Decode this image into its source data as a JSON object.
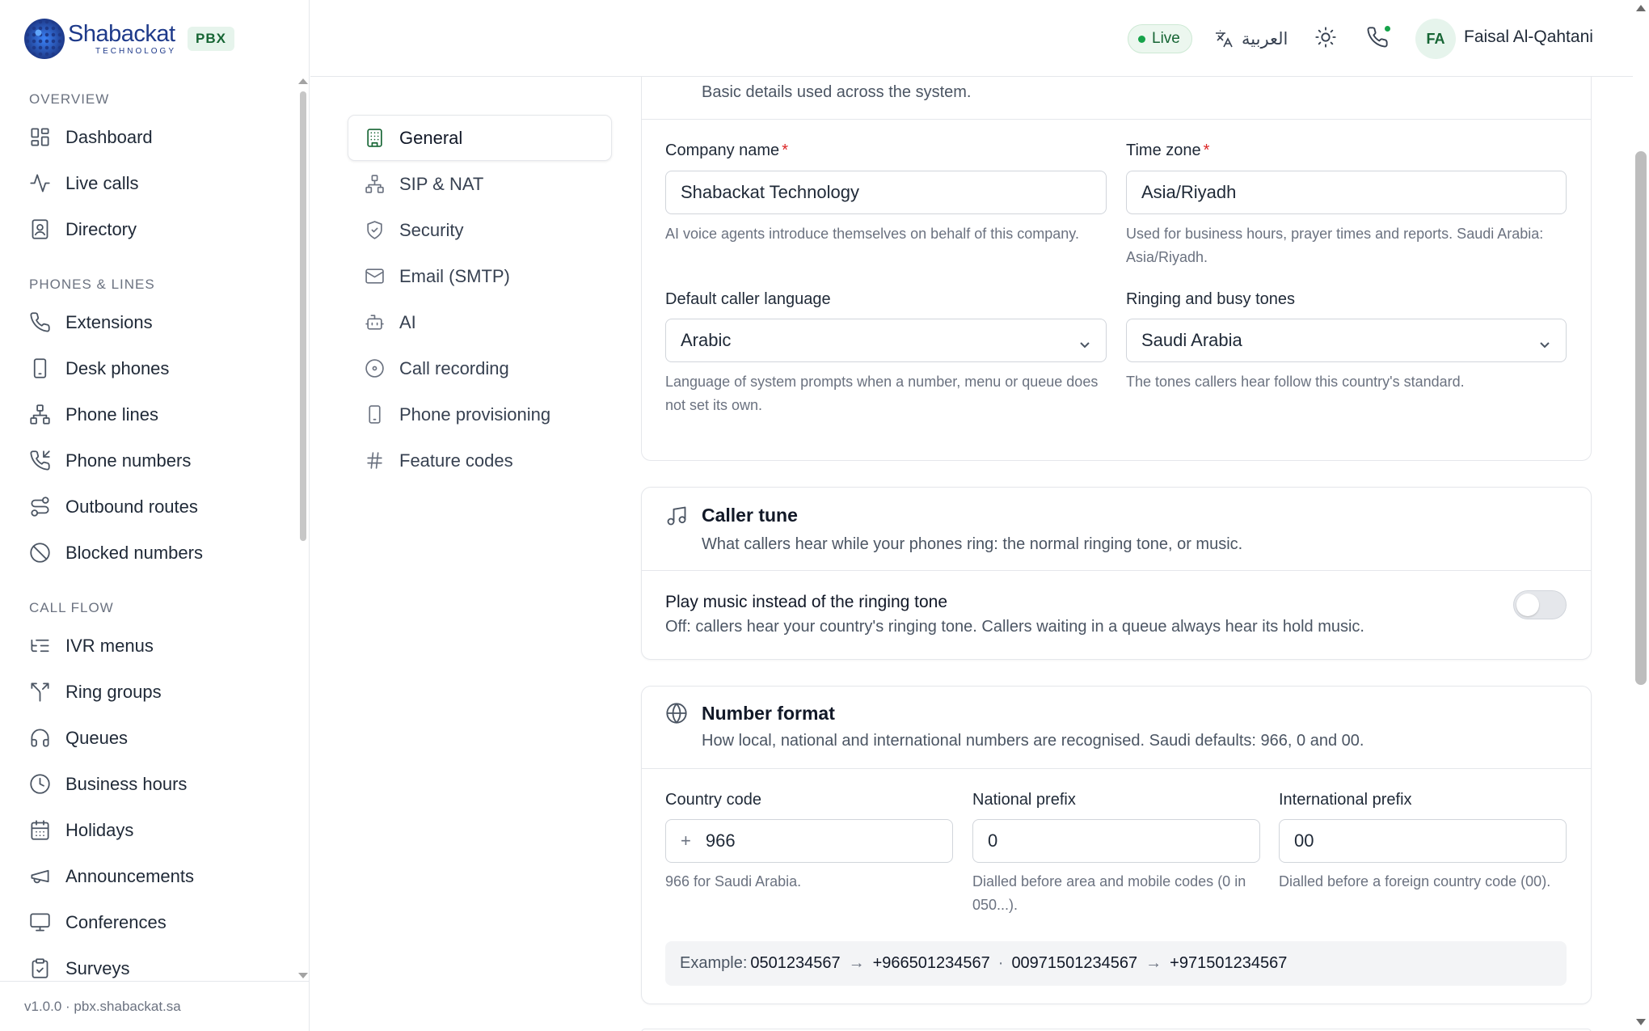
{
  "brand": {
    "name": "Shabackat",
    "tagline": "TECHNOLOGY",
    "badge": "PBX"
  },
  "sidebar": {
    "sections": [
      {
        "title": "OVERVIEW",
        "items": [
          {
            "label": "Dashboard",
            "icon": "dashboard-icon"
          },
          {
            "label": "Live calls",
            "icon": "activity-icon"
          },
          {
            "label": "Directory",
            "icon": "contact-book-icon"
          }
        ]
      },
      {
        "title": "PHONES & LINES",
        "items": [
          {
            "label": "Extensions",
            "icon": "phone-icon"
          },
          {
            "label": "Desk phones",
            "icon": "smartphone-icon"
          },
          {
            "label": "Phone lines",
            "icon": "network-icon"
          },
          {
            "label": "Phone numbers",
            "icon": "phone-incoming-icon"
          },
          {
            "label": "Outbound routes",
            "icon": "route-icon"
          },
          {
            "label": "Blocked numbers",
            "icon": "ban-icon"
          }
        ]
      },
      {
        "title": "CALL FLOW",
        "items": [
          {
            "label": "IVR menus",
            "icon": "list-tree-icon"
          },
          {
            "label": "Ring groups",
            "icon": "split-icon"
          },
          {
            "label": "Queues",
            "icon": "headphones-icon"
          },
          {
            "label": "Business hours",
            "icon": "clock-icon"
          },
          {
            "label": "Holidays",
            "icon": "calendar-icon"
          },
          {
            "label": "Announcements",
            "icon": "megaphone-icon"
          },
          {
            "label": "Conferences",
            "icon": "monitor-icon"
          },
          {
            "label": "Surveys",
            "icon": "clipboard-check-icon"
          }
        ]
      }
    ],
    "footer": "v1.0.0 · pbx.shabackat.sa"
  },
  "header": {
    "status": "Live",
    "language": "العربية",
    "avatar_initials": "FA",
    "user_name": "Faisal Al-Qahtani"
  },
  "settings_nav": [
    {
      "label": "General",
      "icon": "building-icon",
      "active": true
    },
    {
      "label": "SIP & NAT",
      "icon": "network-icon",
      "active": false
    },
    {
      "label": "Security",
      "icon": "shield-check-icon",
      "active": false
    },
    {
      "label": "Email (SMTP)",
      "icon": "mail-icon",
      "active": false
    },
    {
      "label": "AI",
      "icon": "bot-icon",
      "active": false
    },
    {
      "label": "Call recording",
      "icon": "disc-icon",
      "active": false
    },
    {
      "label": "Phone provisioning",
      "icon": "smartphone-icon",
      "active": false
    },
    {
      "label": "Feature codes",
      "icon": "hash-icon",
      "active": false
    }
  ],
  "general_card": {
    "description": "Basic details used across the system.",
    "company_name": {
      "label": "Company name",
      "value": "Shabackat Technology",
      "help": "AI voice agents introduce themselves on behalf of this company."
    },
    "time_zone": {
      "label": "Time zone",
      "value": "Asia/Riyadh",
      "help": "Used for business hours, prayer times and reports. Saudi Arabia: Asia/Riyadh."
    },
    "caller_language": {
      "label": "Default caller language",
      "value": "Arabic",
      "help": "Language of system prompts when a number, menu or queue does not set its own."
    },
    "tones": {
      "label": "Ringing and busy tones",
      "value": "Saudi Arabia",
      "help": "The tones callers hear follow this country's standard."
    }
  },
  "caller_tune_card": {
    "title": "Caller tune",
    "subtitle": "What callers hear while your phones ring: the normal ringing tone, or music.",
    "toggle_label": "Play music instead of the ringing tone",
    "toggle_help": "Off: callers hear your country's ringing tone. Callers waiting in a queue always hear its hold music.",
    "toggle_on": false
  },
  "number_format_card": {
    "title": "Number format",
    "subtitle": "How local, national and international numbers are recognised. Saudi defaults: 966, 0 and 00.",
    "country_code": {
      "label": "Country code",
      "prefix": "+",
      "value": "966",
      "help": "966 for Saudi Arabia."
    },
    "national_prefix": {
      "label": "National prefix",
      "value": "0",
      "help": "Dialled before area and mobile codes (0 in 050...)."
    },
    "international_prefix": {
      "label": "International prefix",
      "value": "00",
      "help": "Dialled before a foreign country code (00)."
    },
    "example": {
      "label": "Example:",
      "local": "0501234567",
      "local_e164": "+966501234567",
      "intl": "00971501234567",
      "intl_e164": "+971501234567",
      "arrow": "→",
      "separator": "·"
    }
  },
  "colors": {
    "accent": "#166534",
    "live_dot": "#16a34a",
    "required": "#dc2626"
  }
}
